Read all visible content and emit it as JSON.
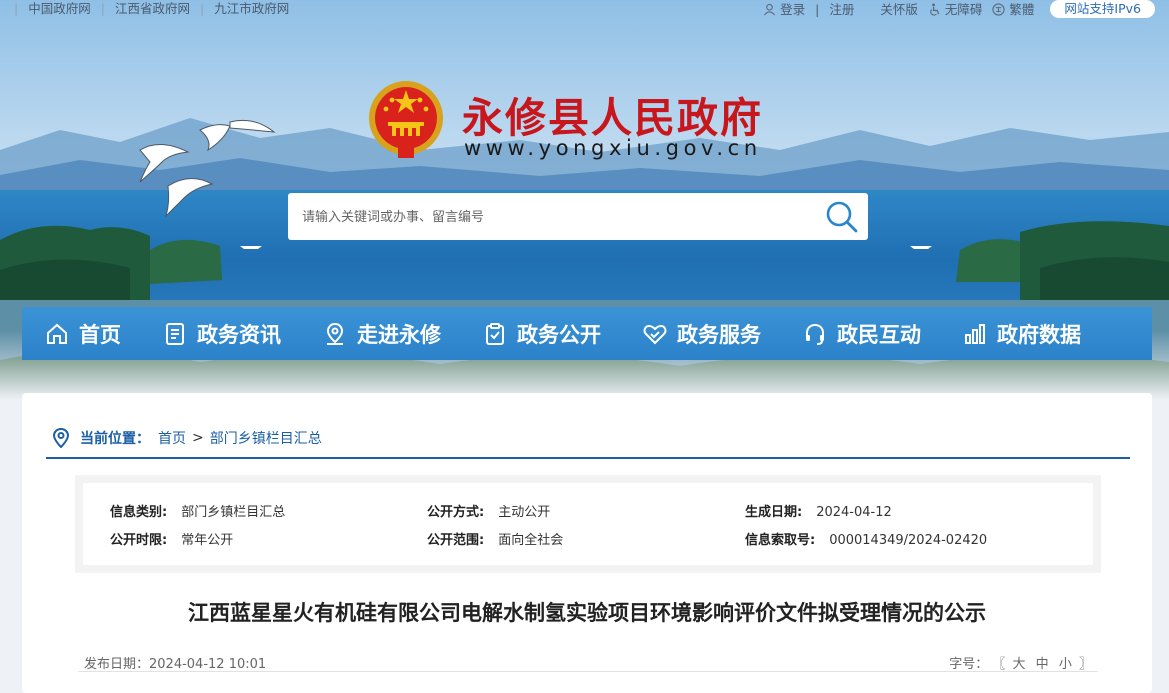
{
  "topbar": {
    "links": [
      "中国政府网",
      "江西省政府网",
      "九江市政府网"
    ],
    "login": "登录",
    "register": "注册",
    "care_mode": "关怀版",
    "accessible": "无障碍",
    "traditional": "繁體",
    "ipv6": "网站支持IPv6"
  },
  "header": {
    "site_name": "永修县人民政府",
    "site_url": "www.yongxiu.gov.cn"
  },
  "search": {
    "placeholder": "请输入关键词或办事、留言编号",
    "icon": "search-icon"
  },
  "nav": {
    "items": [
      {
        "label": "首页",
        "icon": "home-icon"
      },
      {
        "label": "政务资讯",
        "icon": "document-icon"
      },
      {
        "label": "走进永修",
        "icon": "location-icon"
      },
      {
        "label": "政务公开",
        "icon": "clipboard-check-icon"
      },
      {
        "label": "政务服务",
        "icon": "handshake-icon"
      },
      {
        "label": "政民互动",
        "icon": "headset-icon"
      },
      {
        "label": "政府数据",
        "icon": "bar-chart-icon"
      }
    ]
  },
  "breadcrumb": {
    "label": "当前位置：",
    "items": [
      "首页",
      "部门乡镇栏目汇总"
    ],
    "separator": ">"
  },
  "meta": {
    "category_label": "信息类别:",
    "category_value": "部门乡镇栏目汇总",
    "method_label": "公开方式:",
    "method_value": "主动公开",
    "date_label": "生成日期:",
    "date_value": "2024-04-12",
    "period_label": "公开时限:",
    "period_value": "常年公开",
    "scope_label": "公开范围:",
    "scope_value": "面向全社会",
    "index_label": "信息索取号:",
    "index_value": "000014349/2024-02420"
  },
  "article": {
    "title": "江西蓝星星火有机硅有限公司电解水制氢实验项目环境影响评价文件拟受理情况的公示",
    "publish_label": "发布日期：",
    "publish_date": "2024-04-12 10:01",
    "font_label": "字号：",
    "font_open": "〖",
    "font_large": "大",
    "font_medium": "中",
    "font_small": "小",
    "font_close": "〗"
  },
  "colors": {
    "nav_blue": "#2f88cd",
    "title_red": "#c8161d",
    "link_blue": "#1b5fa5"
  }
}
